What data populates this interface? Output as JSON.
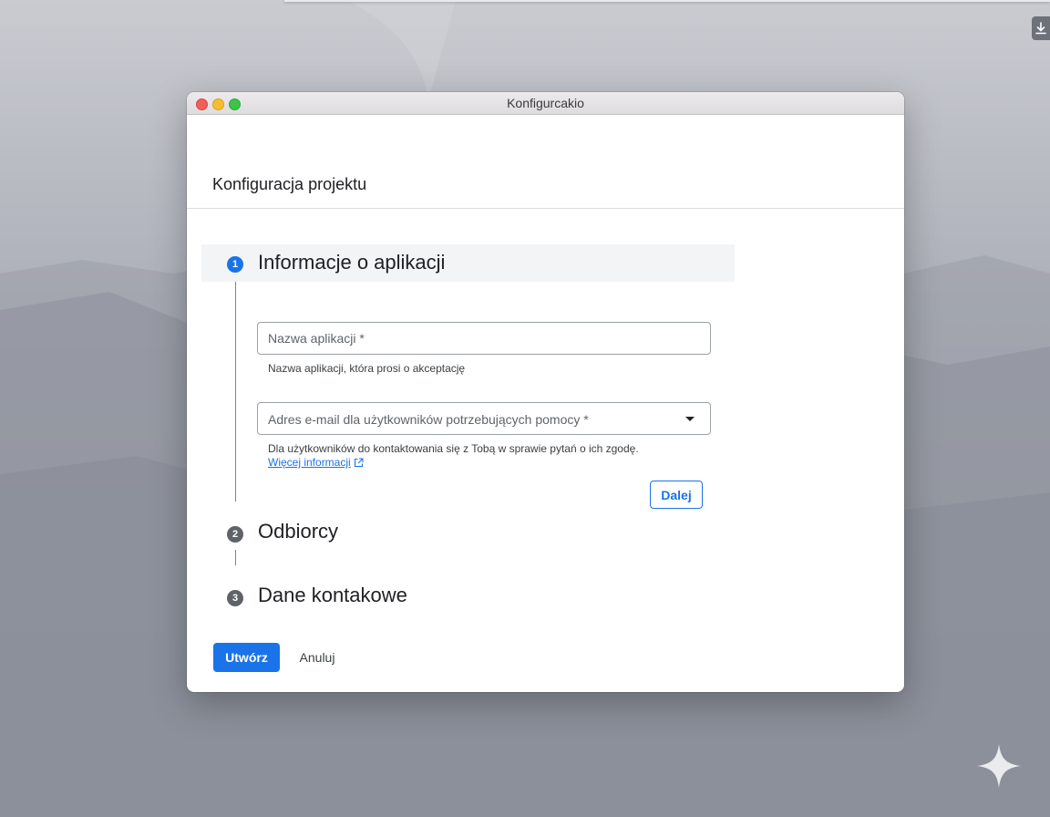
{
  "window": {
    "title": "Konfigurcakio"
  },
  "page": {
    "title": "Konfiguracja projektu"
  },
  "steps": [
    {
      "number": "1",
      "label": "Informacje o aplikacji",
      "state": "active"
    },
    {
      "number": "2",
      "label": "Odbiorcy",
      "state": "inactive"
    },
    {
      "number": "3",
      "label": "Dane kontakowe",
      "state": "inactive"
    }
  ],
  "form": {
    "app_name": {
      "value": "",
      "placeholder": "Nazwa aplikacji *",
      "hint": "Nazwa aplikacji, która prosi o akceptację"
    },
    "support_email": {
      "selected": "Adres e-mail dla użytkowników potrzebujących pomocy *",
      "hint": "Dla użytkowników do kontaktowania się z Tobą w sprawie pytań o ich zgodę.",
      "link_label": "Więcej informacji"
    },
    "next_label": "Dalej"
  },
  "actions": {
    "create_label": "Utwórz",
    "cancel_label": "Anuluj"
  },
  "icons": {
    "external_link": "external-link-icon",
    "dropdown": "chevron-down-icon",
    "download": "download-icon",
    "sparkle": "sparkle-icon"
  },
  "colors": {
    "accent": "#1a73e8",
    "step_inactive": "#5f6368",
    "close": "#f15f56",
    "minimize": "#f7bd2f",
    "maximize": "#3cc444"
  }
}
